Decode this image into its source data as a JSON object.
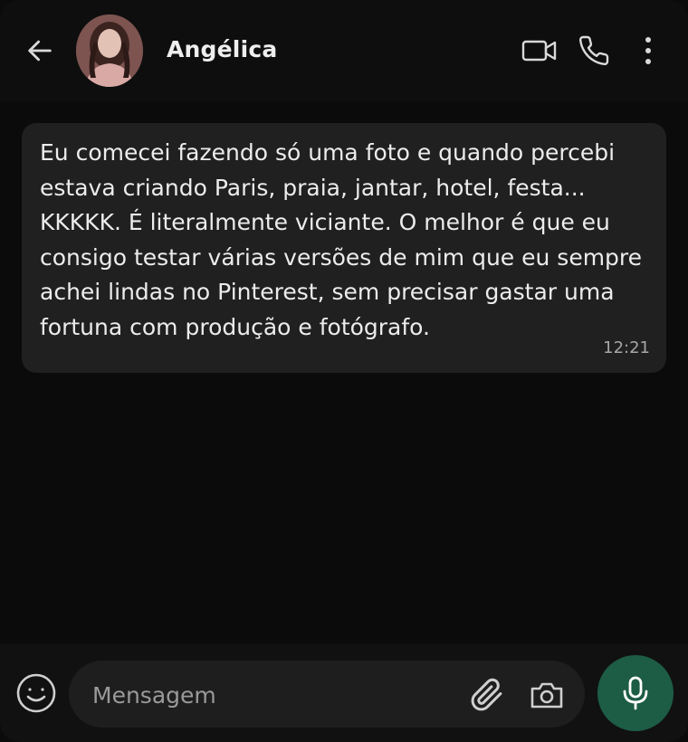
{
  "header": {
    "contact_name": "Angélica",
    "icons": {
      "back": "back-arrow-icon",
      "avatar": "contact-avatar",
      "video": "video-camera-icon",
      "call": "phone-icon",
      "menu": "more-vertical-icon"
    }
  },
  "messages": [
    {
      "direction": "incoming",
      "text": "Eu comecei fazendo só uma foto e quando percebi\nestava criando Paris, praia, jantar, hotel, festa...\nKKKKK. É literalmente viciante. O melhor é que eu\nconsigo testar várias versões de mim que eu sempre\nachei lindas no Pinterest, sem precisar gastar uma\nfortuna com produção e fotógrafo.",
      "time": "12:21"
    }
  ],
  "composer": {
    "placeholder": "Mensagem",
    "value": "",
    "icons": {
      "emoji": "emoji-icon",
      "attach": "paperclip-icon",
      "camera": "camera-icon",
      "mic": "microphone-icon"
    }
  },
  "colors": {
    "background": "#0b0b0b",
    "bubble": "#202020",
    "mic_button": "#1d5c45",
    "icon": "#d9d9d9"
  }
}
